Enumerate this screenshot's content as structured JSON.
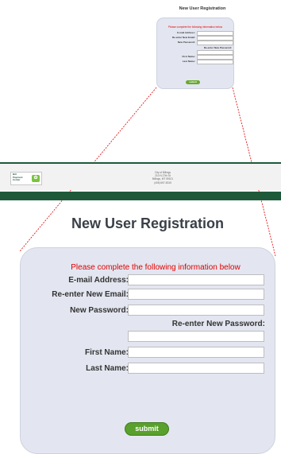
{
  "thumbnail": {
    "title": "New User Registration",
    "instructions": "Please complete the following information below",
    "labels": [
      "E-mail Address:",
      "Re-enter New Email:",
      "New Password:",
      "First Name:",
      "Last Name:"
    ],
    "reenter_password_label": "Re-enter New Password:",
    "submit_label": "submit"
  },
  "header": {
    "logo_text": "Bill\nPayment\nCenter",
    "logo_icon": "leaf-icon",
    "address": [
      "City of Billings",
      "210 N 27th St",
      "Billings, MT 59101",
      "(406) 657-8315"
    ]
  },
  "page": {
    "title": "New User Registration"
  },
  "form": {
    "instructions": "Please complete the following information below",
    "email_label": "E-mail Address:",
    "reenter_email_label": "Re-enter New Email:",
    "password_label": "New Password:",
    "reenter_password_label": "Re-enter New Password:",
    "first_name_label": "First Name:",
    "last_name_label": "Last Name:",
    "submit_label": "submit"
  },
  "colors": {
    "instruction_red": "#e00000",
    "header_green": "#1e5a3a",
    "button_green": "#5aa02c",
    "panel_bg": "#e3e6f0"
  }
}
